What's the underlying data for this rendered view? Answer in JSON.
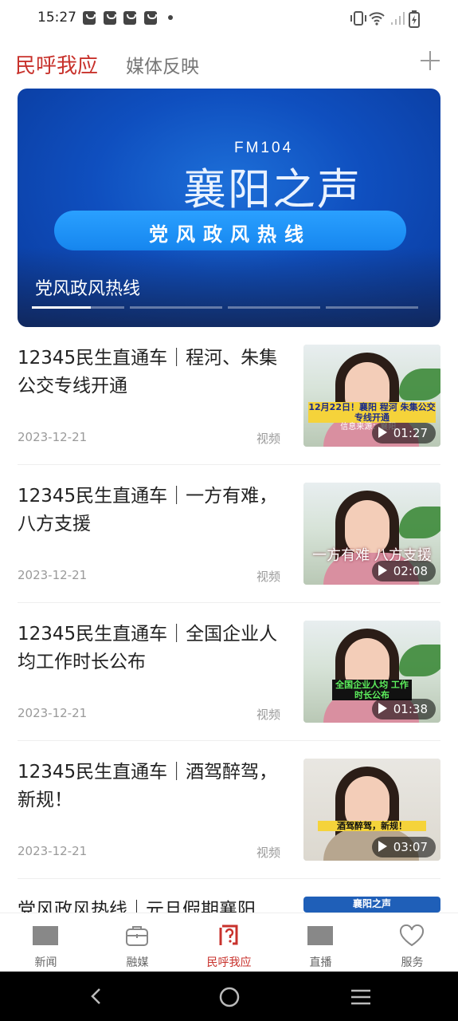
{
  "status_bar": {
    "time": "15:27"
  },
  "top_tabs": {
    "active": "民呼我应",
    "other": "媒体反映"
  },
  "banner": {
    "fm": "FM104",
    "station": "襄阳之声",
    "slogan": "党风政风热线",
    "caption": "党风政风热线",
    "slide_count": 4,
    "active_slide": 1
  },
  "news": [
    {
      "title": "12345民生直通车｜程河、朱集公交专线开通",
      "date": "2023-12-21",
      "type": "视频",
      "duration": "01:27",
      "thumb_text": "12月22日！襄阳 程河 朱集公交专线开通",
      "thumb_text_small": "信息来源：襄阳..."
    },
    {
      "title": "12345民生直通车｜一方有难，八方支援",
      "date": "2023-12-21",
      "type": "视频",
      "duration": "02:08",
      "thumb_text": "一方有难 八方支援"
    },
    {
      "title": "12345民生直通车｜全国企业人均工作时长公布",
      "date": "2023-12-21",
      "type": "视频",
      "duration": "01:38",
      "thumb_text": "全国企业人均 工作时长公布"
    },
    {
      "title": "12345民生直通车｜酒驾醉驾，新规！",
      "date": "2023-12-21",
      "type": "视频",
      "duration": "03:07",
      "thumb_text": "酒驾醉驾，新规！"
    },
    {
      "title": "党风政风热线｜元旦假期襄阳",
      "thumb_text": "襄阳之声"
    }
  ],
  "bottom_nav": [
    {
      "label": "新闻",
      "icon": "tv-icon"
    },
    {
      "label": "融媒",
      "icon": "briefcase-icon"
    },
    {
      "label": "民呼我应",
      "icon": "question-icon",
      "active": true
    },
    {
      "label": "直播",
      "icon": "tv-icon"
    },
    {
      "label": "服务",
      "icon": "heart-icon"
    }
  ],
  "colors": {
    "accent": "#c8322c",
    "banner_blue": "#0f4fbf"
  }
}
